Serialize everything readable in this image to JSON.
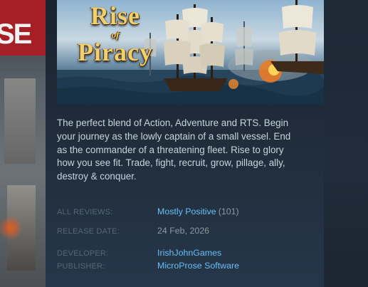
{
  "background": {
    "brand_fragment": "SE"
  },
  "capsule": {
    "title_line1": "Rise",
    "title_line2": "of",
    "title_line3": "Piracy"
  },
  "description": "The perfect blend of Action, Adventure and RTS. Begin your journey as the lowly captain of a small vessel. End as the commander of a threatening fleet. Rise to glory how you see fit. Trade, fight, recruit, grow, pillage, ally, destroy & conquer.",
  "reviews": {
    "label": "ALL REVIEWS:",
    "summary": "Mostly Positive",
    "count": "(101)"
  },
  "release": {
    "label": "RELEASE DATE:",
    "date": "24 Feb, 2026"
  },
  "developer": {
    "label": "DEVELOPER:",
    "name": "IrishJohnGames"
  },
  "publisher": {
    "label": "PUBLISHER:",
    "name": "MicroProse Software"
  },
  "colors": {
    "link": "#66c0f4",
    "text": "#c6d4df",
    "label": "#556772",
    "muted": "#8f98a0",
    "brand_red": "#a61f24"
  }
}
